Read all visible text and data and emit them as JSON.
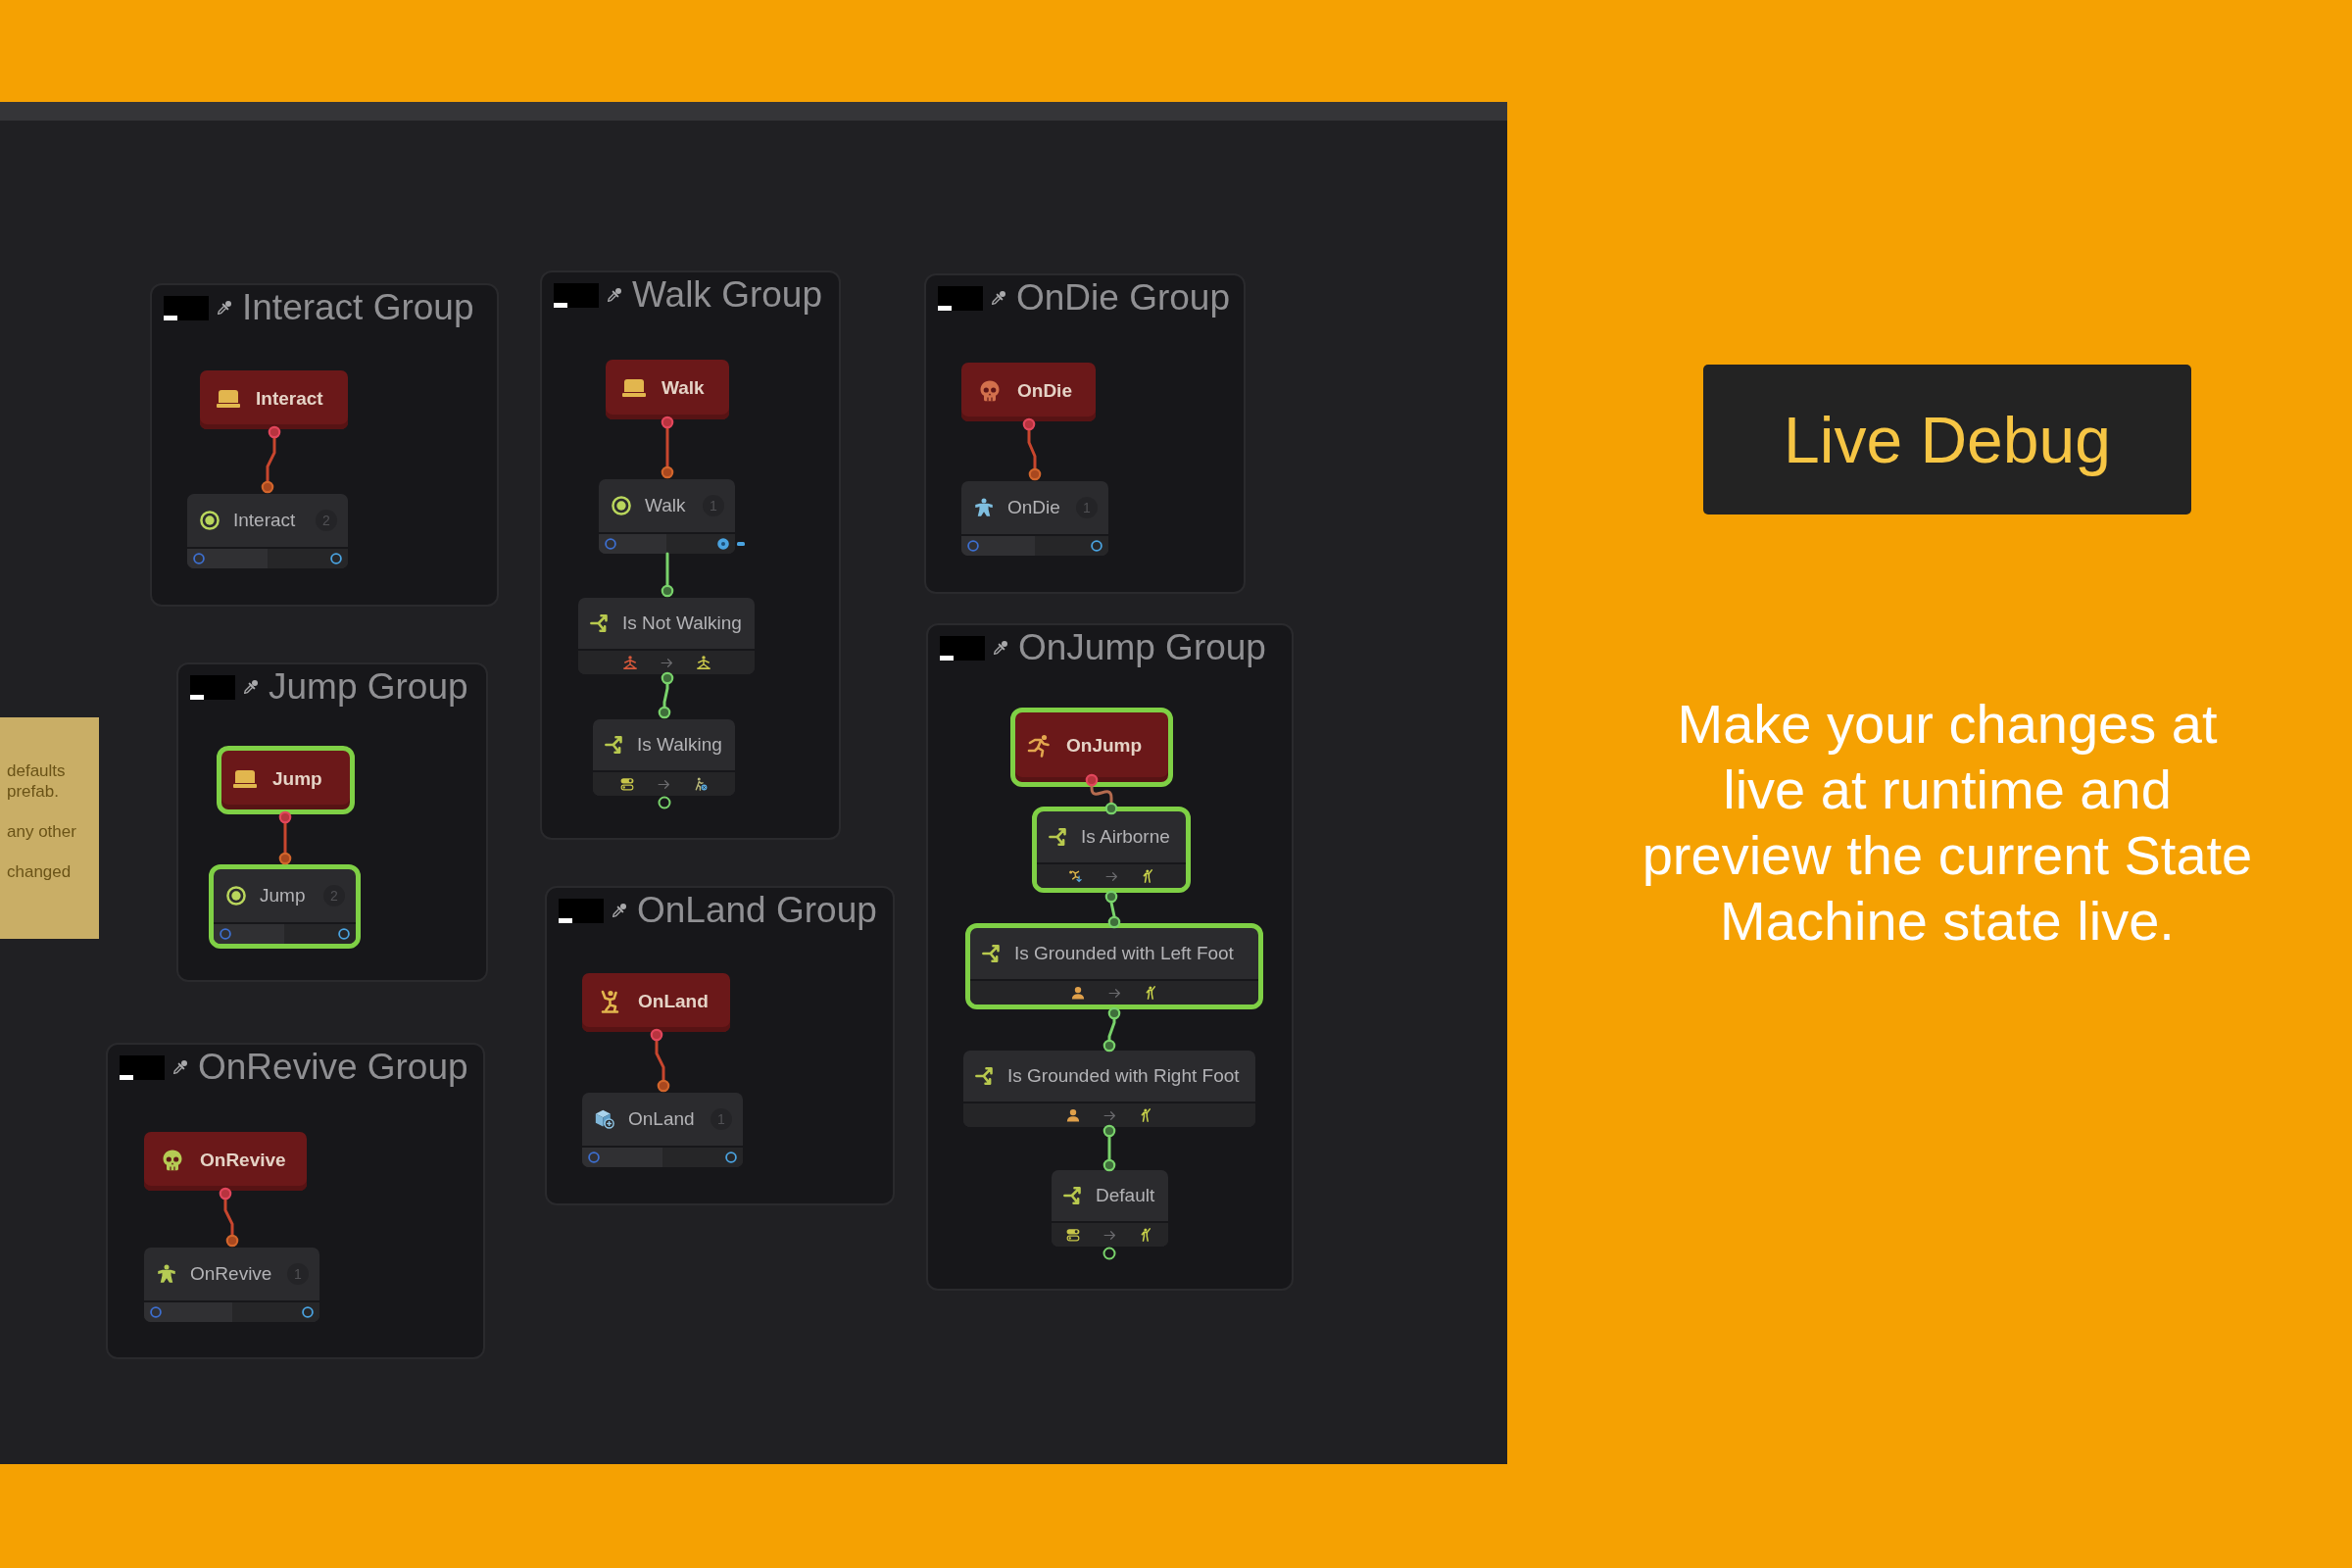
{
  "canvas": {
    "note": {
      "paragraphs": [
        {
          "lines": [
            "defaults",
            "prefab."
          ]
        },
        {
          "lines": [
            "any other"
          ]
        },
        {
          "lines": [
            "changed"
          ]
        }
      ]
    },
    "groups": [
      {
        "title": "Interact Group",
        "nodes": [
          {
            "kind": "trigger",
            "label": "Interact",
            "active": false
          },
          {
            "kind": "state",
            "label": "Interact",
            "badge": "2",
            "active": false
          }
        ]
      },
      {
        "title": "Jump Group",
        "nodes": [
          {
            "kind": "trigger",
            "label": "Jump",
            "active": true
          },
          {
            "kind": "state",
            "label": "Jump",
            "badge": "2",
            "active": true
          }
        ]
      },
      {
        "title": "OnRevive Group",
        "nodes": [
          {
            "kind": "trigger",
            "label": "OnRevive",
            "active": false
          },
          {
            "kind": "state",
            "label": "OnRevive",
            "badge": "1",
            "active": false
          }
        ]
      },
      {
        "title": "Walk Group",
        "nodes": [
          {
            "kind": "trigger",
            "label": "Walk",
            "active": false
          },
          {
            "kind": "state",
            "label": "Walk",
            "badge": "1",
            "active": false
          },
          {
            "kind": "condition",
            "label": "Is Not Walking",
            "active": false
          },
          {
            "kind": "condition",
            "label": "Is Walking",
            "active": false
          }
        ]
      },
      {
        "title": "OnLand Group",
        "nodes": [
          {
            "kind": "trigger",
            "label": "OnLand",
            "active": false
          },
          {
            "kind": "state",
            "label": "OnLand",
            "badge": "1",
            "active": false
          }
        ]
      },
      {
        "title": "OnDie Group",
        "nodes": [
          {
            "kind": "trigger",
            "label": "OnDie",
            "active": false
          },
          {
            "kind": "state",
            "label": "OnDie",
            "badge": "1",
            "active": false
          }
        ]
      },
      {
        "title": "OnJump Group",
        "nodes": [
          {
            "kind": "trigger",
            "label": "OnJump",
            "active": true
          },
          {
            "kind": "condition",
            "label": "Is Airborne",
            "active": true
          },
          {
            "kind": "condition",
            "label": "Is Grounded with Left Foot",
            "active": true
          },
          {
            "kind": "condition",
            "label": "Is Grounded with Right Foot",
            "active": false
          },
          {
            "kind": "condition",
            "label": "Default",
            "active": false
          }
        ]
      }
    ]
  },
  "live_debug": {
    "title": "Live Debug",
    "description": "Make your changes at live at runtime and preview the current State Machine state live."
  }
}
